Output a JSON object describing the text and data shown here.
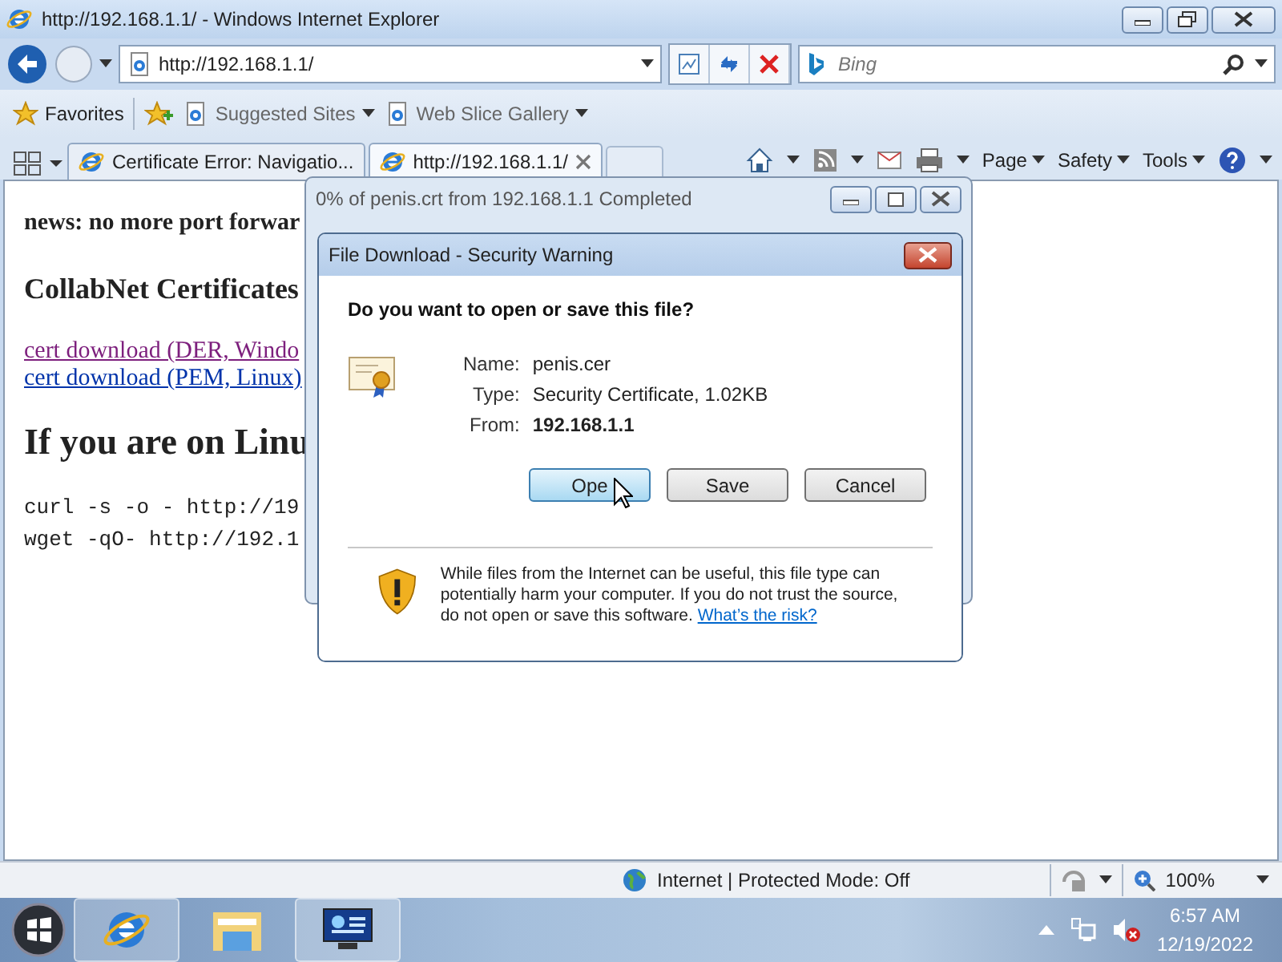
{
  "window": {
    "title": "http://192.168.1.1/ - Windows Internet Explorer"
  },
  "address_bar": {
    "value": "http://192.168.1.1/"
  },
  "search": {
    "placeholder": "Bing"
  },
  "favorites_bar": {
    "favorites": "Favorites",
    "items": [
      "Suggested Sites",
      "Web Slice Gallery"
    ]
  },
  "tabs": [
    {
      "label": "Certificate Error: Navigatio...",
      "selected": false
    },
    {
      "label": "http://192.168.1.1/",
      "selected": true
    }
  ],
  "command_bar": [
    "Page",
    "Safety",
    "Tools"
  ],
  "page": {
    "news": "news: no more port forwar",
    "heading": "CollabNet Certificates",
    "links": [
      {
        "text": "cert download (DER, Windo",
        "visited": true
      },
      {
        "text": "cert download (PEM, Linux)",
        "visited": false
      }
    ],
    "subheading": "If you are on Linu",
    "code": [
      "curl -s -o - http://19",
      "wget -qO- http://192.1"
    ]
  },
  "download_progress": {
    "title": "0% of penis.crt from 192.168.1.1 Completed"
  },
  "dialog": {
    "title": "File Download - Security Warning",
    "question": "Do you want to open or save this file?",
    "fields": [
      {
        "label": "Name:",
        "value": "penis.cer",
        "bold": false
      },
      {
        "label": "Type:",
        "value": "Security Certificate, 1.02KB",
        "bold": false
      },
      {
        "label": "From:",
        "value": "192.168.1.1",
        "bold": true
      }
    ],
    "buttons": [
      {
        "label": "Ope",
        "focused": true
      },
      {
        "label": "Save",
        "focused": false
      },
      {
        "label": "Cancel",
        "focused": false
      }
    ],
    "warning": {
      "text": "While files from the Internet can be useful, this file type can potentially harm your computer. If you do not trust the source, do not open or save this software.",
      "link": "What’s the risk?"
    }
  },
  "status_bar": {
    "zone": "Internet | Protected Mode: Off",
    "zoom": "100%"
  },
  "taskbar": {
    "time": "6:57 AM",
    "date": "12/19/2022"
  }
}
